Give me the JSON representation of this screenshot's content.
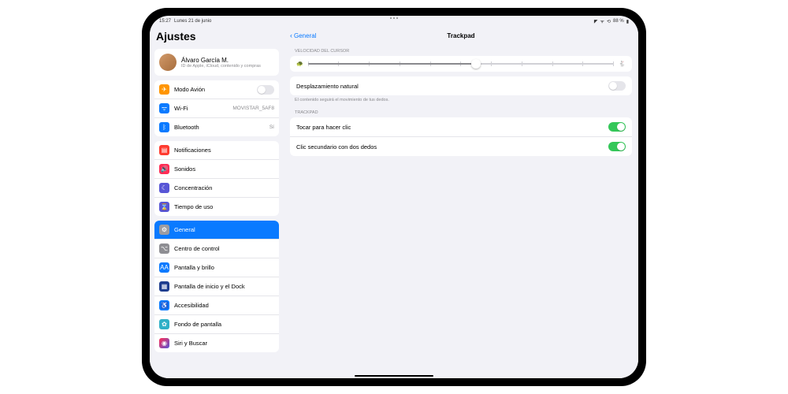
{
  "status": {
    "time": "15:27",
    "date": "Lunes 21 de junio",
    "battery": "88 %"
  },
  "sidebar": {
    "title": "Ajustes",
    "profile": {
      "name": "Álvaro García M.",
      "sub": "ID de Apple, iCloud, contenido y compras"
    },
    "g1": {
      "airplane": "Modo Avión",
      "wifi": "Wi-Fi",
      "wifi_val": "MOVISTAR_5AF8",
      "bt": "Bluetooth",
      "bt_val": "Sí"
    },
    "g2": {
      "notif": "Notificaciones",
      "sounds": "Sonidos",
      "focus": "Concentración",
      "screentime": "Tiempo de uso"
    },
    "g3": {
      "general": "General",
      "control": "Centro de control",
      "display": "Pantalla y brillo",
      "home": "Pantalla de inicio y el Dock",
      "access": "Accesibilidad",
      "wallpaper": "Fondo de pantalla",
      "siri": "Siri y Buscar"
    }
  },
  "detail": {
    "back": "General",
    "title": "Trackpad",
    "s1_header": "VELOCIDAD DEL CURSOR",
    "slider_pct": 55,
    "natural": "Desplazamiento natural",
    "natural_footer": "El contenido seguirá el movimiento de tus dedos.",
    "s2_header": "TRACKPAD",
    "tap": "Tocar para hacer clic",
    "secondary": "Clic secundario con dos dedos"
  },
  "colors": {
    "orange": "#ff9500",
    "blue": "#0a7aff",
    "red": "#ff3b30",
    "pink": "#ff2d55",
    "purple": "#5856d6",
    "gray": "#8e8e93",
    "teal": "#30b0c7",
    "darkblue": "#1e3d8f",
    "green": "#34c759"
  }
}
